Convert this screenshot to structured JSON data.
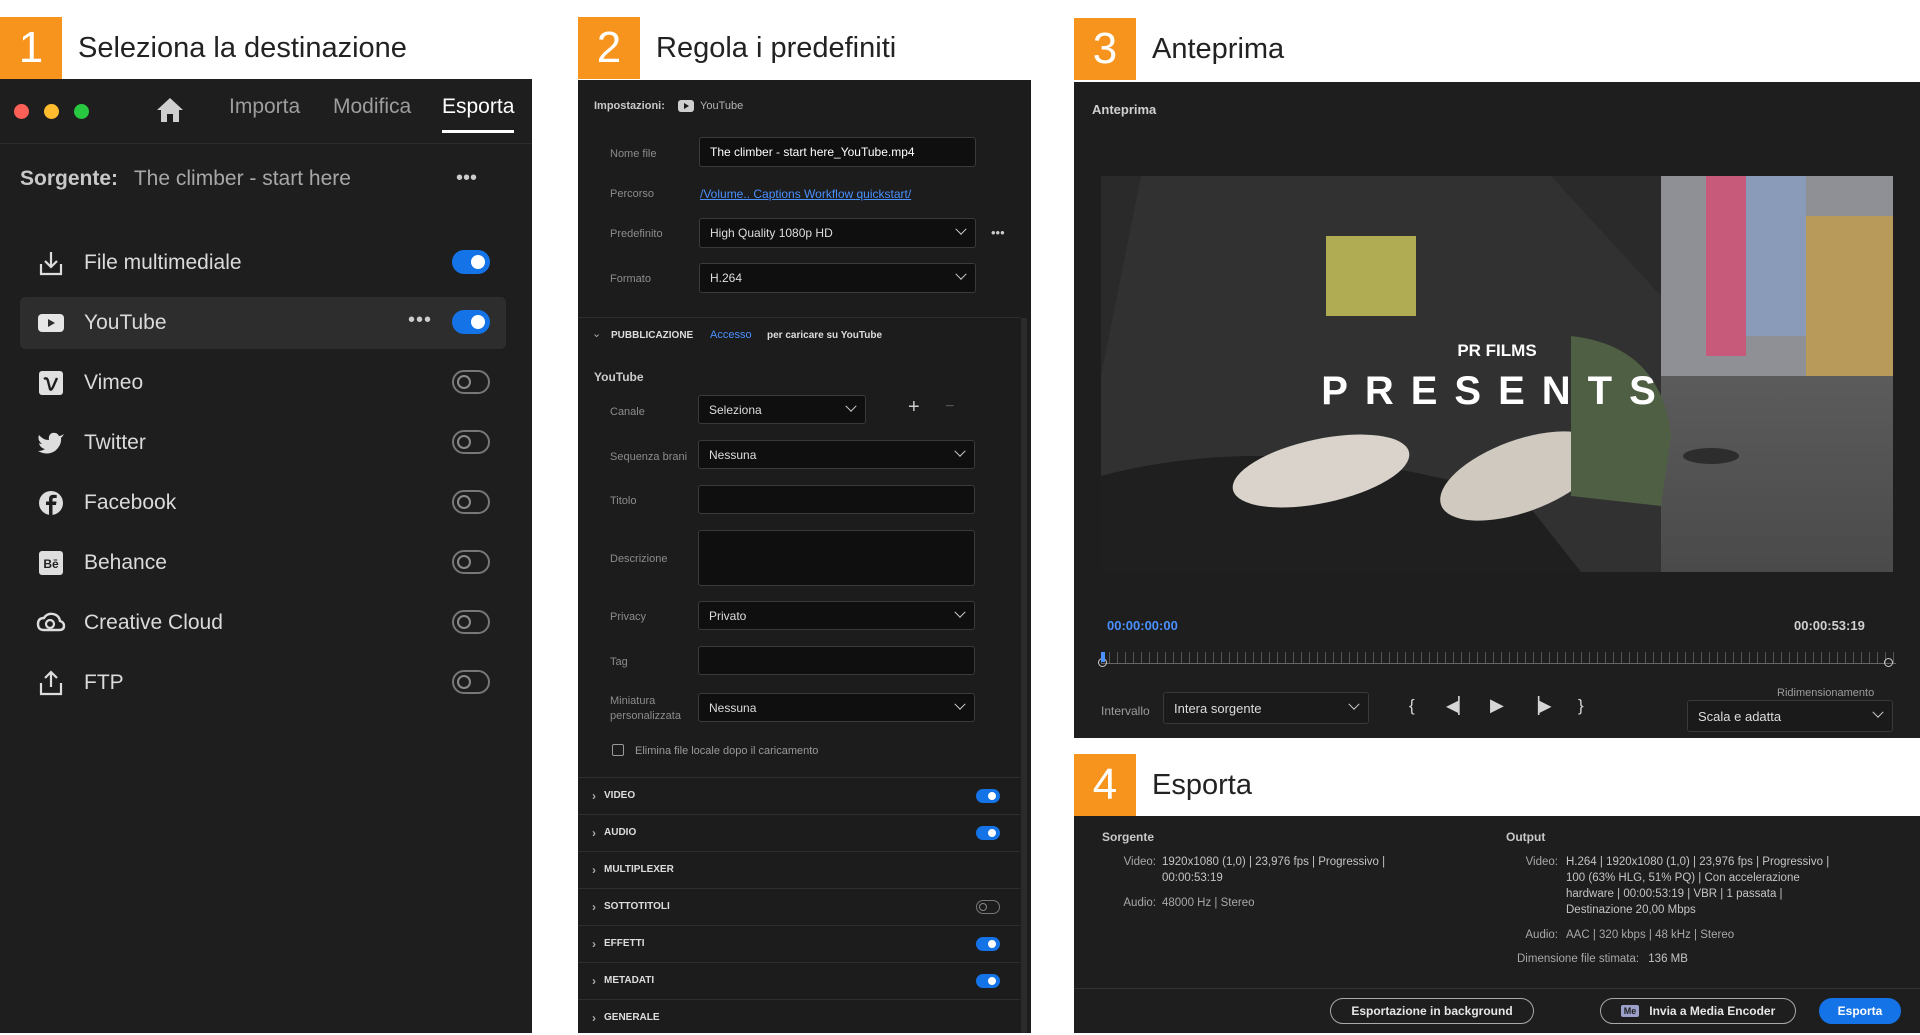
{
  "steps": [
    {
      "num": "1",
      "title": "Seleziona la destinazione"
    },
    {
      "num": "2",
      "title": "Regola i predefiniti"
    },
    {
      "num": "3",
      "title": "Anteprima"
    },
    {
      "num": "4",
      "title": "Esporta"
    }
  ],
  "panel1": {
    "nav": {
      "import": "Importa",
      "edit": "Modifica",
      "export": "Esporta"
    },
    "source_label": "Sorgente:",
    "source_value": "The climber - start here",
    "more": "•••",
    "destinations": [
      {
        "label": "File multimediale",
        "icon": "download-icon",
        "on": true
      },
      {
        "label": "YouTube",
        "icon": "youtube-icon",
        "on": true
      },
      {
        "label": "Vimeo",
        "icon": "vimeo-icon",
        "on": false
      },
      {
        "label": "Twitter",
        "icon": "twitter-icon",
        "on": false
      },
      {
        "label": "Facebook",
        "icon": "facebook-icon",
        "on": false
      },
      {
        "label": "Behance",
        "icon": "behance-icon",
        "on": false
      },
      {
        "label": "Creative Cloud",
        "icon": "creative-cloud-icon",
        "on": false
      },
      {
        "label": "FTP",
        "icon": "upload-icon",
        "on": false
      }
    ]
  },
  "panel2": {
    "settings_label": "Impostazioni:",
    "settings_value": "YouTube",
    "filename_label": "Nome file",
    "filename_value": "The climber - start here_YouTube.mp4",
    "path_label": "Percorso",
    "path_value": "/Volume.. Captions Workflow quickstart/",
    "preset_label": "Predefinito",
    "preset_value": "High Quality 1080p HD",
    "format_label": "Formato",
    "format_value": "H.264",
    "publish_header": "PUBBLICAZIONE",
    "login": "Accesso",
    "login_hint": "per caricare su YouTube",
    "youtube_header": "YouTube",
    "channel_label": "Canale",
    "channel_value": "Seleziona",
    "playlist_label": "Sequenza brani",
    "playlist_value": "Nessuna",
    "title_label": "Titolo",
    "title_value": "",
    "desc_label": "Descrizione",
    "desc_value": "",
    "privacy_label": "Privacy",
    "privacy_value": "Privato",
    "tag_label": "Tag",
    "tag_value": "",
    "thumb_label_1": "Miniatura",
    "thumb_label_2": "personalizzata",
    "thumb_value": "Nessuna",
    "delete_local": "Elimina file locale dopo il caricamento",
    "sections": [
      {
        "label": "VIDEO",
        "on": true
      },
      {
        "label": "AUDIO",
        "on": true
      },
      {
        "label": "MULTIPLEXER",
        "on": null
      },
      {
        "label": "SOTTOTITOLI",
        "on": false
      },
      {
        "label": "EFFETTI",
        "on": true
      },
      {
        "label": "METADATI",
        "on": true
      },
      {
        "label": "GENERALE",
        "on": null
      }
    ]
  },
  "panel3": {
    "title": "Anteprima",
    "overlay_small": "PR FILMS",
    "overlay_big": "PRESENTS",
    "time_start": "00:00:00:00",
    "time_end": "00:00:53:19",
    "range_label": "Intervallo",
    "range_value": "Intera sorgente",
    "resize_label": "Ridimensionamento",
    "resize_value": "Scala e adatta"
  },
  "panel4": {
    "source_header": "Sorgente",
    "output_header": "Output",
    "src_video_label": "Video:",
    "src_video_1": "1920x1080 (1,0)  |  23,976 fps  |  Progressivo  |",
    "src_video_2": "00:00:53:19",
    "src_audio_label": "Audio:",
    "src_audio": "48000 Hz  |  Stereo",
    "out_video_label": "Video:",
    "out_video_1": "H.264  |  1920x1080 (1,0)  |  23,976 fps  |  Progressivo  |",
    "out_video_2": "100 (63% HLG, 51% PQ)  |  Con accelerazione",
    "out_video_3": "hardware  |  00:00:53:19  |  VBR  |  1 passata  |",
    "out_video_4": "Destinazione 20,00 Mbps",
    "out_audio_label": "Audio:",
    "out_audio": "AAC  |  320 kbps  |  48 kHz  |  Stereo",
    "size_label": "Dimensione file stimata:",
    "size_value": "136 MB",
    "bg_button": "Esportazione in background",
    "me_badge": "Me",
    "me_button": "Invia a Media Encoder",
    "export_button": "Esporta"
  },
  "colors": {
    "accent": "#1473e6",
    "step": "#f7941d",
    "panel": "#1e1e1e"
  }
}
